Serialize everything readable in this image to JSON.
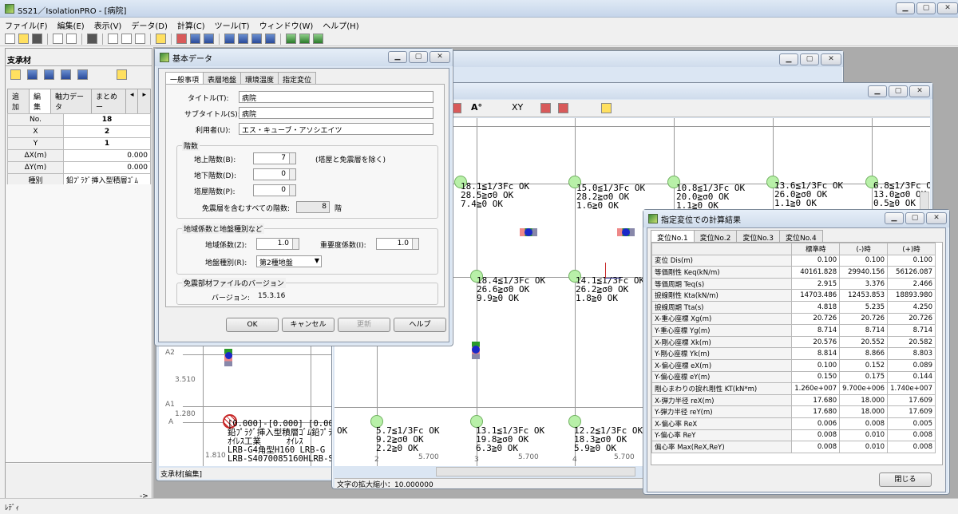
{
  "app": {
    "title": "SS21／IsolationPRO - [病院]"
  },
  "menu": [
    "ファイル(F)",
    "編集(E)",
    "表示(V)",
    "データ(D)",
    "計算(C)",
    "ツール(T)",
    "ウィンドウ(W)",
    "ヘルプ(H)"
  ],
  "left": {
    "title": "支承材",
    "tabs": [
      "追加",
      "編集",
      "軸力データ",
      "まとめー"
    ],
    "rows": [
      [
        "No.",
        "18"
      ],
      [
        "X",
        "2"
      ],
      [
        "Y",
        "1"
      ],
      [
        "ΔX(m)",
        "0.000"
      ],
      [
        "ΔY(m)",
        "0.000"
      ],
      [
        "種別",
        "鉛ﾌﾟﾗｸﾞ挿入型積層ｺﾞﾑ"
      ],
      [
        "メーカー",
        "ｵｲﾚｽ工業"
      ],
      [
        "シリーズ",
        "LRB-G4角型H160"
      ],
      [
        "製品",
        "LRB-S4070085160H"
      ],
      [
        "設置角度…",
        "0.0"
      ]
    ],
    "footer": "支承材[編集]",
    "arrow": "->"
  },
  "plan": {
    "labels": [
      "A2",
      "3.510",
      "A1",
      "1.280",
      "A",
      "1.810"
    ],
    "annot": "[0.000]-[0.000] [0.00\n鉛ﾌﾟﾗｸﾞ挿入型積層ｺﾞﾑ鉛ﾌﾟﾗ\nｵｲﾚｽ工業     ｵｲﾚｽ\nLRB-G4角型H160 LRB-G\nLRB-S4070085160HLRB-S",
    "axis": [
      "1",
      "2",
      "3",
      "4"
    ],
    "spans": [
      "5.700",
      "5.700",
      "5.700"
    ]
  },
  "stress": {
    "toolbar_text": [
      "A°",
      "XY"
    ],
    "cells": [
      {
        "t": "18.1≦1/3Fc OK\n28.5≧σ0 OK\n7.4≧0 OK"
      },
      {
        "t": "15.0≦1/3Fc OK\n28.2≧σ0 OK\n1.6≧0 OK"
      },
      {
        "t": "10.8≦1/3Fc OK\n20.0≧σ0 OK\n1.1≧0 OK"
      },
      {
        "t": "13.6≦1/3Fc OK\n26.0≧σ0 OK\n1.1≧0 OK"
      },
      {
        "t": "6.8≦1/3Fc OK\n13.0≧σ0 OK\n0.5≧0 OK"
      },
      {
        "t": "18.4≦1/3Fc OK\n26.6≧σ0 OK\n9.9≧0 OK"
      },
      {
        "t": "14.1≦1/3Fc OK\n26.2≧σ0 OK\n1.8≧0 OK"
      },
      {
        "t": "5.7≦1/3Fc OK\n9.2≧σ0 OK\n2.2≧0 OK"
      },
      {
        "t": "13.1≦1/3Fc OK\n19.8≧σ0 OK\n6.3≧0 OK"
      },
      {
        "t": "12.2≦1/3Fc OK\n18.3≧σ0 OK\n5.9≧0 OK"
      }
    ],
    "edge_ok": "OK",
    "status": "文字の拡大縮小：10.000000",
    "axis": [
      "2",
      "3",
      "4"
    ],
    "spans": [
      "5.700",
      "5.700",
      "5.700"
    ]
  },
  "basic": {
    "title": "基本データ",
    "tabs": [
      "一般事項",
      "表層地盤",
      "環境温度",
      "指定変位"
    ],
    "title_label": "タイトル(T):",
    "title_val": "病院",
    "subtitle_label": "サブタイトル(S):",
    "subtitle_val": "病院",
    "user_label": "利用者(U):",
    "user_val": "エス・キューブ・アソシエイツ",
    "floors_group": "階数",
    "above_label": "地上階数(B):",
    "above_val": "7",
    "below_label": "地下階数(D):",
    "below_val": "0",
    "tower_label": "塔屋階数(P):",
    "tower_val": "0",
    "note": "(塔屋と免震層を除く)",
    "total_label": "免震層を含むすべての階数:",
    "total_val": "8",
    "total_unit": "階",
    "region_group": "地域係数と地盤種別など",
    "zone_label": "地域係数(Z):",
    "zone_val": "1.0",
    "imp_label": "重要度係数(I):",
    "imp_val": "1.0",
    "soil_label": "地盤種別(R):",
    "soil_val": "第2種地盤",
    "version_group": "免震部材ファイルのバージョン",
    "version_label": "バージョン:",
    "version_val": "15.3.16",
    "ok": "OK",
    "cancel": "キャンセル",
    "update": "更新",
    "help": "ヘルプ"
  },
  "result": {
    "title": "指定変位での計算結果",
    "tabs": [
      "変位No.1",
      "変位No.2",
      "変位No.3",
      "変位No.4"
    ],
    "head": [
      "",
      "標準時",
      "(-)時",
      "(+)時"
    ],
    "rows": [
      [
        "変位 Dis(m)",
        "0.100",
        "0.100",
        "0.100"
      ],
      [
        "等価剛性 Keq(kN/m)",
        "40161.828",
        "29940.156",
        "56126.087"
      ],
      [
        "等価周期 Teq(s)",
        "2.915",
        "3.376",
        "2.466"
      ],
      [
        "捩線剛性 Kta(kN/m)",
        "14703.486",
        "12453.853",
        "18893.980"
      ],
      [
        "捩線周期 Tta(s)",
        "4.818",
        "5.235",
        "4.250"
      ],
      [
        "X-重心座標 Xg(m)",
        "20.726",
        "20.726",
        "20.726"
      ],
      [
        "Y-重心座標 Yg(m)",
        "8.714",
        "8.714",
        "8.714"
      ],
      [
        "X-剛心座標 Xk(m)",
        "20.576",
        "20.552",
        "20.582"
      ],
      [
        "Y-剛心座標 Yk(m)",
        "8.814",
        "8.866",
        "8.803"
      ],
      [
        "X-偏心座標 eX(m)",
        "0.100",
        "0.152",
        "0.089"
      ],
      [
        "Y-偏心座標 eY(m)",
        "0.150",
        "0.175",
        "0.144"
      ],
      [
        "剛心まわりの捩れ剛性 KT(kN*m)",
        "1.260e+007",
        "9.700e+006",
        "1.740e+007"
      ],
      [
        "X-弾力半径 reX(m)",
        "17.680",
        "18.000",
        "17.609"
      ],
      [
        "Y-弾力半径 reY(m)",
        "17.680",
        "18.000",
        "17.609"
      ],
      [
        "X-偏心率 ReX",
        "0.006",
        "0.008",
        "0.005"
      ],
      [
        "Y-偏心率 ReY",
        "0.008",
        "0.010",
        "0.008"
      ],
      [
        "偏心率 Max(ReX,ReY)",
        "0.008",
        "0.010",
        "0.008"
      ]
    ],
    "close": "閉じる"
  },
  "status": "ﾚﾃﾞｨ"
}
